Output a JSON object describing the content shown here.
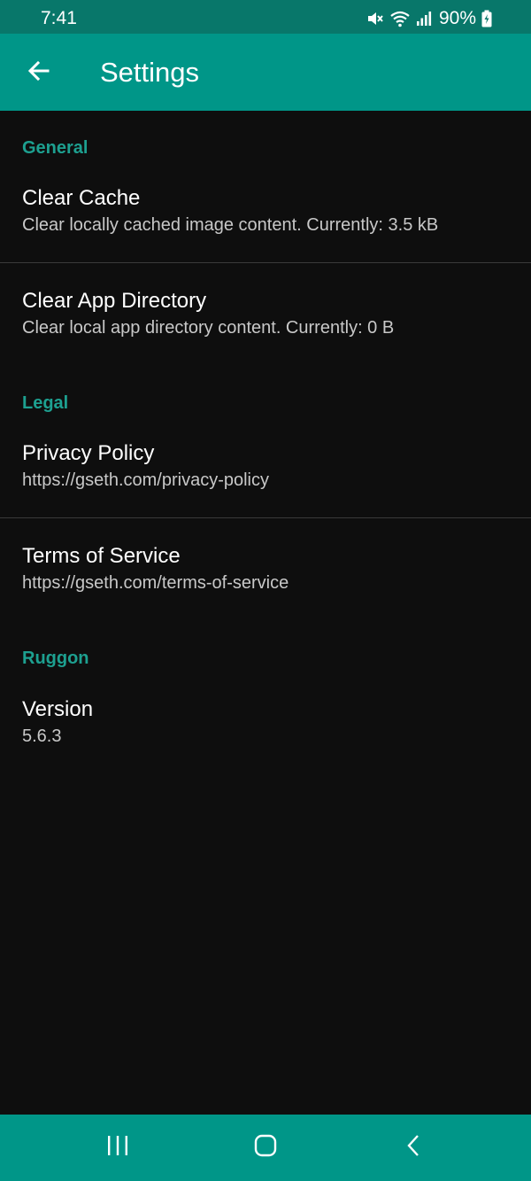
{
  "status_bar": {
    "time": "7:41",
    "battery": "90%",
    "icons": [
      "mute-icon",
      "wifi-icon",
      "signal-icon",
      "battery-charging-icon"
    ]
  },
  "app_bar": {
    "title": "Settings",
    "back_icon": "arrow-left-icon"
  },
  "sections": {
    "general": {
      "header": "General",
      "clear_cache": {
        "title": "Clear Cache",
        "summary": "Clear locally cached image content. Currently: 3.5 kB"
      },
      "clear_app_dir": {
        "title": "Clear App Directory",
        "summary": "Clear local app directory content. Currently: 0 B"
      }
    },
    "legal": {
      "header": "Legal",
      "privacy": {
        "title": "Privacy Policy",
        "summary": "https://gseth.com/privacy-policy"
      },
      "terms": {
        "title": "Terms of Service",
        "summary": "https://gseth.com/terms-of-service"
      }
    },
    "ruggon": {
      "header": "Ruggon",
      "version": {
        "title": "Version",
        "summary": "5.6.3"
      }
    }
  },
  "nav_bar": {
    "buttons": [
      "recents-icon",
      "home-icon",
      "back-icon"
    ]
  },
  "colors": {
    "status_bar": "#08776a",
    "app_bar": "#009688",
    "accent": "#1da090",
    "background": "#0e0e0e"
  }
}
